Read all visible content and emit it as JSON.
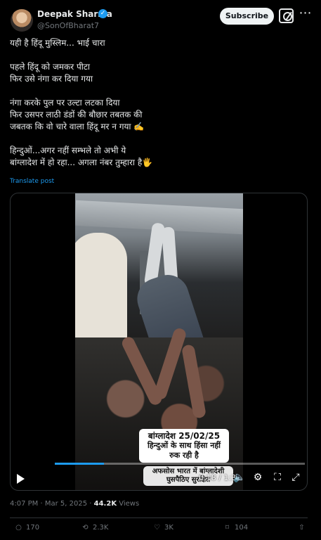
{
  "author": {
    "name": "Deepak Sharma",
    "handle": "@SonOfBharat7",
    "verified": true,
    "avatar": "profile-avatar"
  },
  "header": {
    "subscribe_label": "Subscribe",
    "grok_icon": "grok-icon",
    "more_icon": "more-icon"
  },
  "post": {
    "lines": [
      "यही है हिंदू मुस्लिम... भाई  चारा",
      "",
      "पहले हिंदू को जमकर पीटा",
      "फिर उसे नंगा कर दिया गया",
      "",
      "नंगा करके पुल पर उल्टा लटका दिया",
      "फिर उसपर लाठी डंडों की बौछार तबतक की",
      "जबतक कि वो चारे वाला हिंदू मर न गया ✍️",
      "",
      "हिन्दुओं...अगर नहीं सम्भले तो अभी ये",
      "बांग्लादेश में हो रहा... अगला नंबर तुम्हारा है🖐️"
    ],
    "translate_label": "Translate post"
  },
  "video": {
    "caption_primary": [
      "बांग्लादेश 25/02/25",
      "हिन्दुओं के साथ हिंसा नहीं",
      "रुक रही है"
    ],
    "caption_secondary": [
      "अफसोस भारत में बांग्लादेशी",
      "घुसपैठिए सुरक्षित"
    ],
    "time": "0:18 / 1:31",
    "progress": 0.198,
    "controls": [
      "play-icon",
      "volume-icon",
      "settings-icon",
      "fullscreen-icon",
      "share-icon"
    ]
  },
  "meta": {
    "time": "4:07 PM",
    "separator": "·",
    "date": "Mar 5, 2025",
    "views": "44.2K",
    "views_label": "Views"
  },
  "actions": {
    "replies": "170",
    "reposts": "2.3K",
    "likes": "3K",
    "bookmarks": "104"
  },
  "colors": {
    "background": "#000000",
    "text": "#e7e9ea",
    "secondary": "#71767b",
    "link": "#1d9bf0",
    "border": "#2f3336"
  }
}
